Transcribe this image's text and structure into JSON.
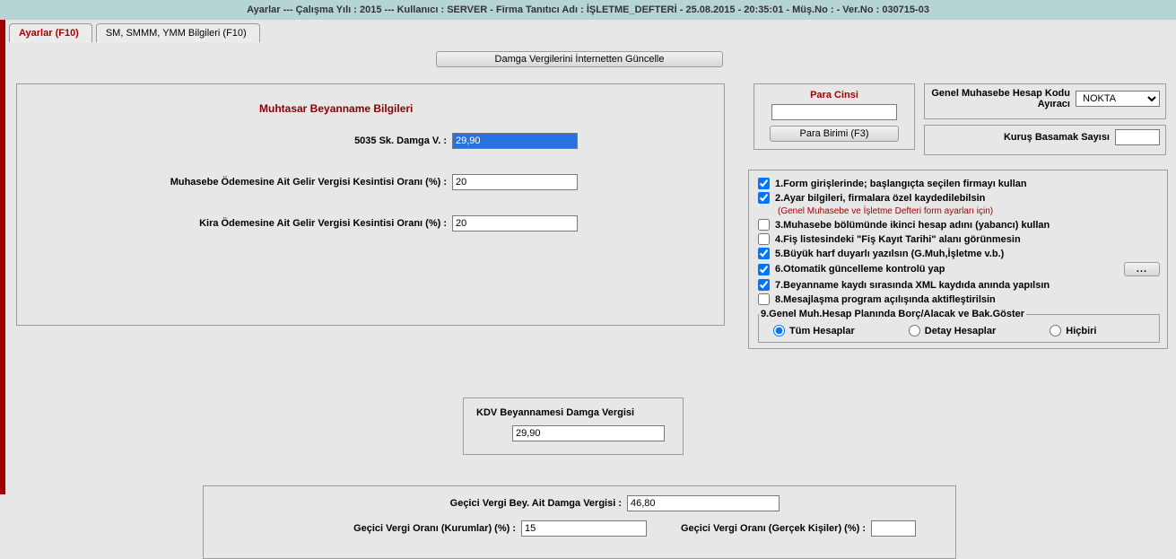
{
  "titlebar": "Ayarlar  ---  Çalışma Yılı : 2015  ---  Kullanıcı : SERVER - Firma Tanıtıcı Adı : İŞLETME_DEFTERİ - 25.08.2015 - 20:35:01 - Müş.No :  - Ver.No : 030715-03",
  "tabs": {
    "t1": "Ayarlar (F10)",
    "t2": "SM, SMMM, YMM Bilgileri (F10)"
  },
  "btnUpdate": "Damga Vergilerini İnternetten Güncelle",
  "muhtasar": {
    "title": "Muhtasar Beyanname Bilgileri",
    "l1": "5035 Sk. Damga V. :",
    "v1": "29,90",
    "l2": "Muhasebe Ödemesine Ait Gelir Vergisi Kesintisi Oranı (%) :",
    "v2": "20",
    "l3": "Kira Ödemesine Ait Gelir Vergisi Kesintisi Oranı (%) :",
    "v3": "20"
  },
  "para": {
    "title": "Para Cinsi",
    "value": "",
    "btn": "Para Birimi (F3)"
  },
  "right": {
    "l1": "Genel Muhasebe Hesap Kodu Ayıracı",
    "v1": "NOKTA",
    "l2": "Kuruş Basamak Sayısı",
    "v2": ""
  },
  "opts": {
    "o1": "1.Form girişlerinde; başlangıçta seçilen firmayı kullan",
    "o2": "2.Ayar bilgileri, firmalara özel kaydedilebilsin",
    "note2": "(Genel Muhasebe ve İşletme Defteri form ayarları için)",
    "o3": "3.Muhasebe bölümünde ikinci hesap adını (yabancı) kullan",
    "o4": "4.Fiş listesindeki \"Fiş Kayıt Tarihi\" alanı görünmesin",
    "o5": "5.Büyük harf duyarlı yazılsın (G.Muh,İşletme v.b.)",
    "o6": "6.Otomatik güncelleme kontrolü yap",
    "o7": "7.Beyanname kaydı sırasında XML kaydıda anında yapılsın",
    "o8": "8.Mesajlaşma program açılışında aktifleştirilsin",
    "fsTitle": "9.Genel Muh.Hesap Planında Borç/Alacak ve Bak.Göster",
    "r1": "Tüm Hesaplar",
    "r2": "Detay Hesaplar",
    "r3": "Hiçbiri"
  },
  "dots": "...",
  "kdv": {
    "title": "KDV Beyannamesi  Damga Vergisi",
    "v": "29,90"
  },
  "gecici": {
    "l1": "Geçici Vergi Bey. Ait Damga Vergisi :",
    "v1": "46,80",
    "l2": "Geçici Vergi Oranı (Kurumlar) (%) :",
    "v2": "15",
    "l3": "Geçici Vergi Oranı (Gerçek Kişiler) (%) :",
    "v3": ""
  }
}
